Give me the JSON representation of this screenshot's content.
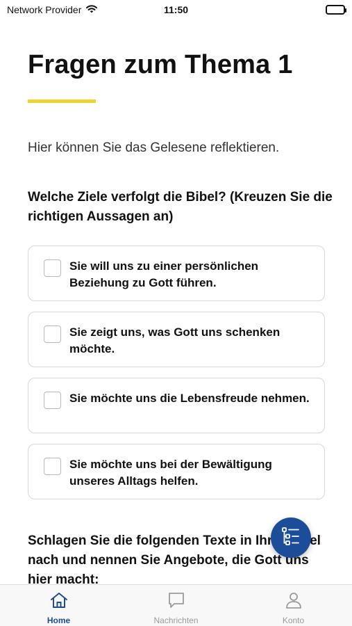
{
  "status_bar": {
    "carrier": "Network Provider",
    "time": "11:50",
    "wifi_icon": "wifi-icon",
    "battery_icon": "battery-icon"
  },
  "page": {
    "title": "Fragen zum Thema 1",
    "intro": "Hier können Sie das Gelesene reflektieren.",
    "question1": "Welche Ziele verfolgt die Bibel? (Kreuzen Sie die richtigen Aussagen an)",
    "options": [
      {
        "label": "Sie will uns zu einer persönlichen Beziehung zu Gott führen.",
        "checked": false
      },
      {
        "label": "Sie zeigt uns, was Gott uns schenken möchte.",
        "checked": false
      },
      {
        "label": "Sie möchte uns die Lebensfreude nehmen.",
        "checked": false
      },
      {
        "label": "Sie möchte uns bei der Bewältigung unseres Alltags helfen.",
        "checked": false
      }
    ],
    "question2": "Schlagen Sie die folgenden Texte in Ihrer Bibel nach und nennen Sie Angebote, die Gott uns hier macht:"
  },
  "fab": {
    "icon": "outline-list-icon"
  },
  "tabs": [
    {
      "label": "Home",
      "icon": "home-icon",
      "active": true
    },
    {
      "label": "Nachrichten",
      "icon": "chat-bubble-icon",
      "active": false
    },
    {
      "label": "Konto",
      "icon": "user-icon",
      "active": false
    }
  ],
  "colors": {
    "accent": "#1c4d99",
    "title_underline": "#f2d230",
    "inactive_tab": "#9a9a9a",
    "border": "#d7d7d7"
  }
}
